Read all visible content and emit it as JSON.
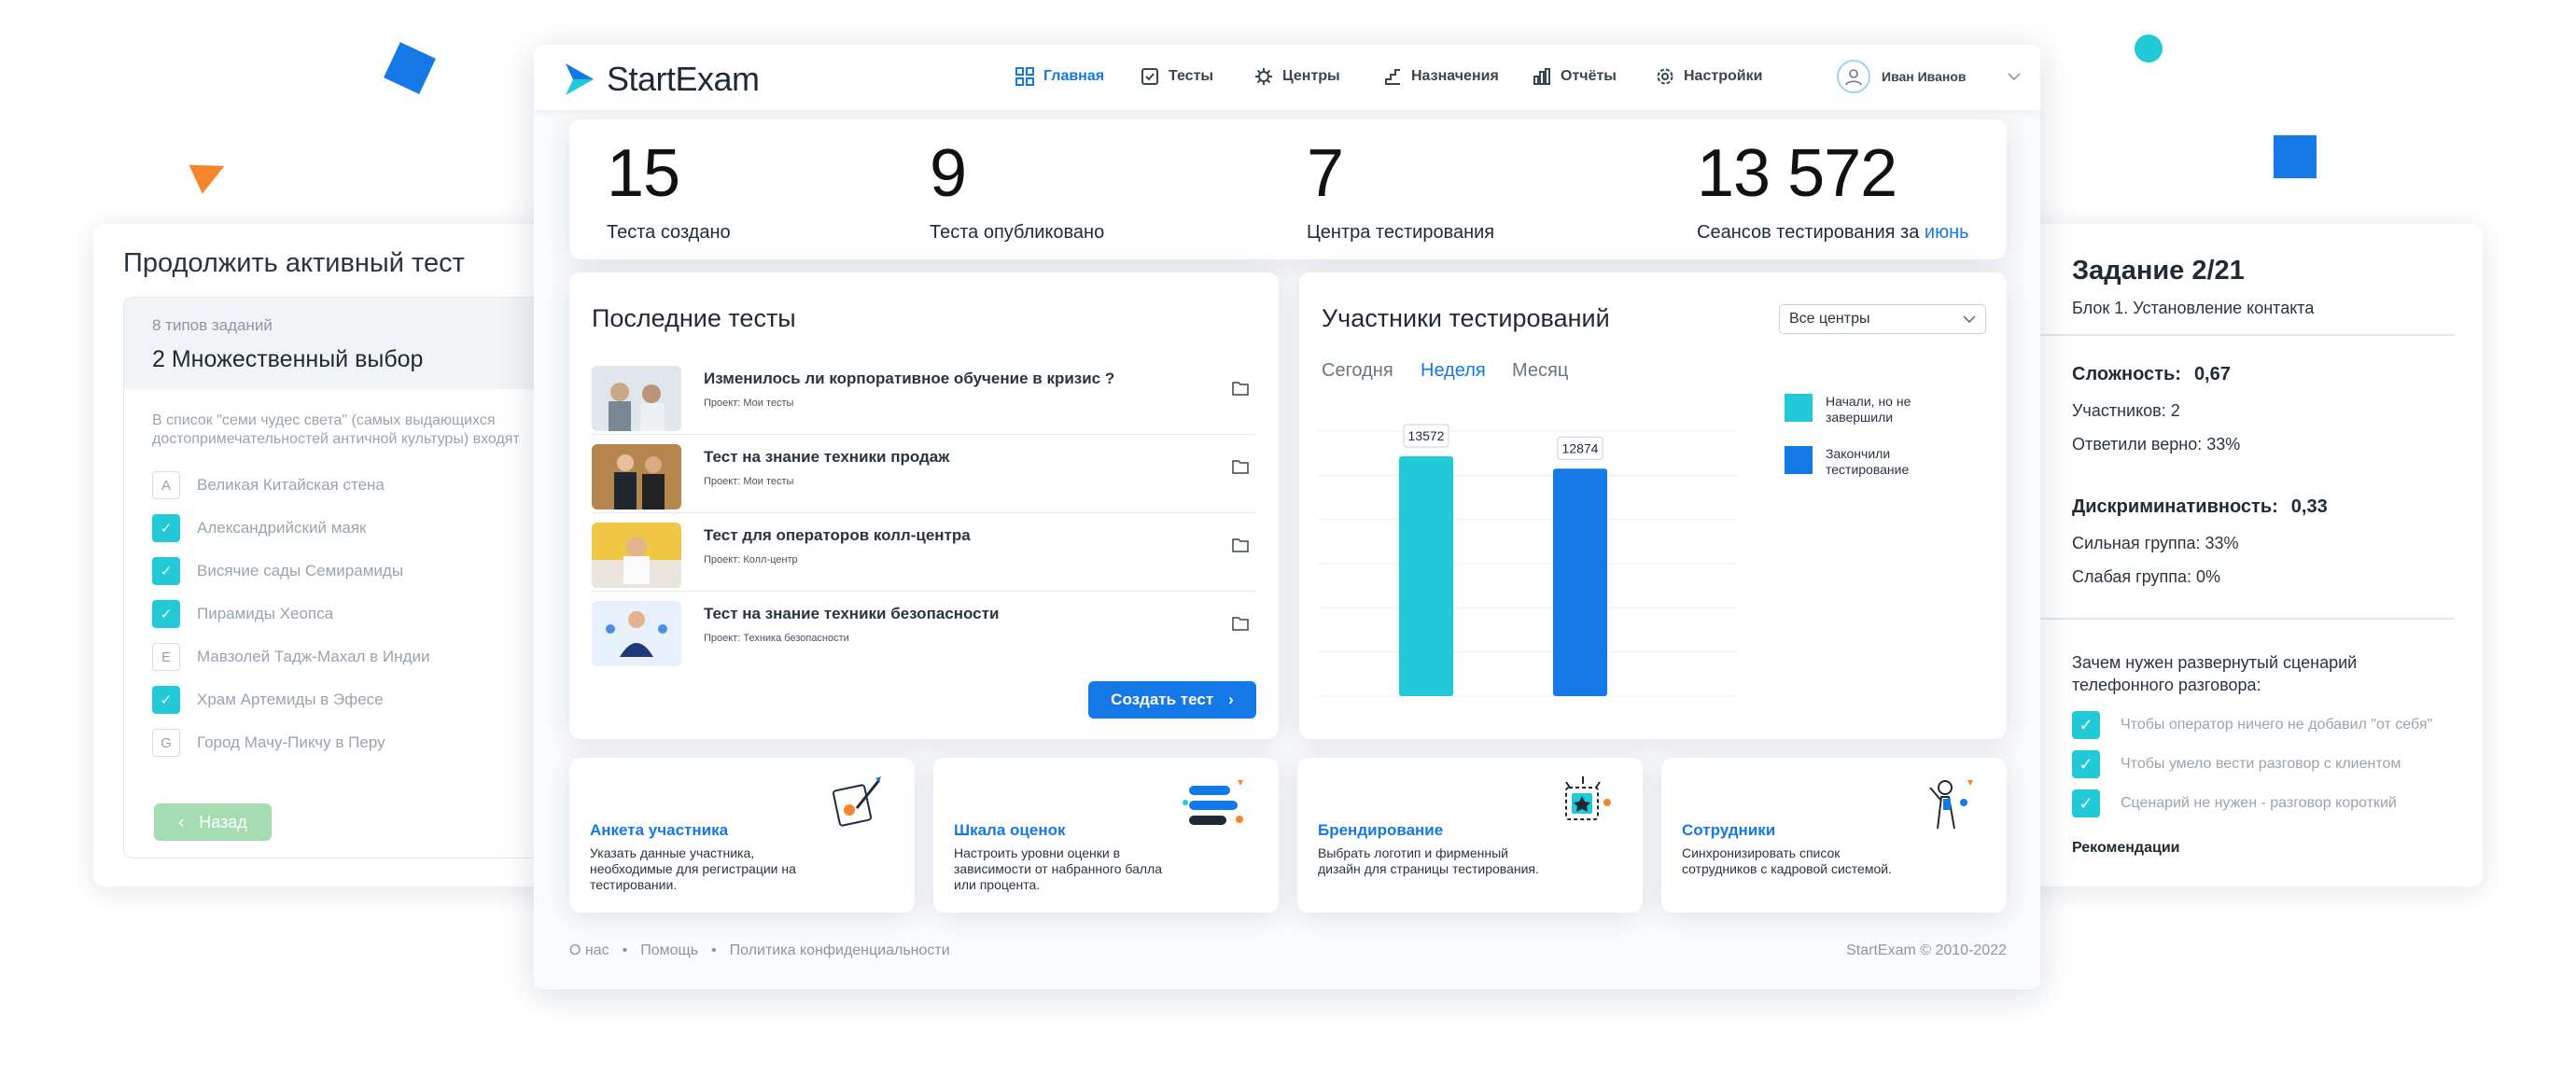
{
  "nav": {
    "brand": "StartExam",
    "items": [
      {
        "label": "Главная",
        "icon": "grid-icon"
      },
      {
        "label": "Тесты",
        "icon": "checkbox-icon"
      },
      {
        "label": "Центры",
        "icon": "gear-network-icon"
      },
      {
        "label": "Назначения",
        "icon": "steps-icon"
      },
      {
        "label": "Отчёты",
        "icon": "bar-chart-icon"
      },
      {
        "label": "Настройки",
        "icon": "settings-icon"
      }
    ],
    "active": "Главная",
    "user": "Иван Иванов"
  },
  "stats": [
    {
      "value": "15",
      "label": "Теста создано"
    },
    {
      "value": "9",
      "label": "Теста опубликовано"
    },
    {
      "value": "7",
      "label": "Центра тестирования"
    },
    {
      "value": "13 572",
      "label": "Сеансов тестирования за",
      "link": "июнь"
    }
  ],
  "recent": {
    "title": "Последние тесты",
    "items": [
      {
        "title": "Изменилось ли корпоративное обучение в кризис ?",
        "project": "Проект: Мои тесты"
      },
      {
        "title": "Тест на знание техники продаж",
        "project": "Проект: Мои тесты"
      },
      {
        "title": "Тест для операторов колл-центра",
        "project": "Проект: Колл-центр"
      },
      {
        "title": "Тест на знание техники безопасности",
        "project": "Проект: Техника безопасности"
      }
    ],
    "create_label": "Создать тест"
  },
  "participants": {
    "title": "Участники тестирований",
    "filter": "Все центры",
    "periods": [
      "Сегодня",
      "Неделя",
      "Месяц"
    ],
    "active_period": "Неделя"
  },
  "chart_data": {
    "type": "bar",
    "categories": [
      "Начали, но не завершили",
      "Закончили тестирование"
    ],
    "values": [
      13572,
      12874
    ],
    "colors": [
      "#22c9d6",
      "#1479e6"
    ],
    "legend": [
      "Начали, но не завершили",
      "Закончили тестирование"
    ],
    "legend_lines": [
      [
        "Начали, но не",
        "завершили"
      ],
      [
        "Закончили",
        "тестирование"
      ]
    ],
    "data_labels": [
      "13572",
      "12874"
    ],
    "grid": true,
    "legend_position": "right"
  },
  "cards": [
    {
      "title": "Анкета участника",
      "desc": "Указать данные участника, необходимые для регистрации на тестировании.",
      "icon": "form-pen-icon"
    },
    {
      "title": "Шкала оценок",
      "desc": "Настроить уровни оценки в зависимости от набранного балла или процента.",
      "icon": "scale-bars-icon"
    },
    {
      "title": "Брендирование",
      "desc": "Выбрать логотип и фирменный дизайн для страницы тестирования.",
      "icon": "star-badge-icon"
    },
    {
      "title": "Сотрудники",
      "desc": "Синхронизировать список сотрудников с кадровой системой.",
      "icon": "employee-icon"
    }
  ],
  "footer": {
    "links": [
      "О нас",
      "Помощь",
      "Политика конфиденциальности"
    ],
    "copyright": "StartExam ©  2010-2022"
  },
  "left": {
    "title": "Продолжить активный тест",
    "types": "8 типов заданий",
    "section": "2 Множественный выбор",
    "question_lines": [
      "В список \"семи чудес света\" (самых выдающихся",
      "достопримечательностей античной культуры) входят"
    ],
    "options": [
      {
        "mark": "A",
        "label": "Великая Китайская стена",
        "checked": false
      },
      {
        "mark": "",
        "label": "Александрийский маяк",
        "checked": true
      },
      {
        "mark": "",
        "label": "Висячие сады Семирамиды",
        "checked": true
      },
      {
        "mark": "",
        "label": "Пирамиды Хеопса",
        "checked": true
      },
      {
        "mark": "E",
        "label": "Мавзолей Тадж-Махал в Индии",
        "checked": false
      },
      {
        "mark": "",
        "label": "Храм Артемиды в Эфесе",
        "checked": true
      },
      {
        "mark": "G",
        "label": "Город Мачу-Пикчу в Перу",
        "checked": false
      }
    ],
    "back_label": "Назад"
  },
  "right": {
    "title": "Задание 2/21",
    "block": "Блок 1. Установление контакта",
    "difficulty_label": "Сложность:",
    "difficulty_value": "0,67",
    "participants": "Участников: 2",
    "correct": "Ответили верно: 33%",
    "discr_label": "Дискриминативность:",
    "discr_value": "0,33",
    "strong": "Сильная группа: 33%",
    "weak": "Слабая группа: 0%",
    "question_lines": [
      "Зачем нужен развернутый сценарий",
      "телефонного разговора:"
    ],
    "answers": [
      "Чтобы оператор ничего не добавил \"от себя\"",
      "Чтобы умело вести разговор с клиентом",
      "Сценарий не нужен - разговор короткий"
    ],
    "recommend": "Рекомендации"
  }
}
